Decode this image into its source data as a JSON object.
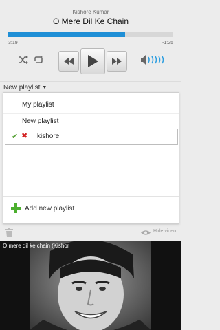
{
  "now_playing": {
    "artist": "Kishore Kumar",
    "title": "O Mere Dil Ke Chain",
    "elapsed": "3:19",
    "remaining": "-1:25",
    "progress_fraction": 0.71
  },
  "controls": {
    "shuffle_icon": "shuffle-icon",
    "repeat_icon": "repeat-icon",
    "prev_icon": "previous-icon",
    "play_icon": "play-icon",
    "next_icon": "next-icon",
    "volume_icon": "volume-icon"
  },
  "playlist_select": {
    "label": "New playlist"
  },
  "dropdown": {
    "items": [
      {
        "label": "My playlist"
      },
      {
        "label": "New playlist"
      }
    ],
    "new_entry": {
      "value": "kishore"
    },
    "add_label": "Add new playlist"
  },
  "footer": {
    "hide_video_label": "Hide video"
  },
  "video": {
    "title": "O mere dil ke chain  (Kishor"
  },
  "colors": {
    "accent": "#1f8fd6",
    "check": "#5aa33a",
    "cross": "#d21f1f",
    "plus": "#4caf2f"
  }
}
